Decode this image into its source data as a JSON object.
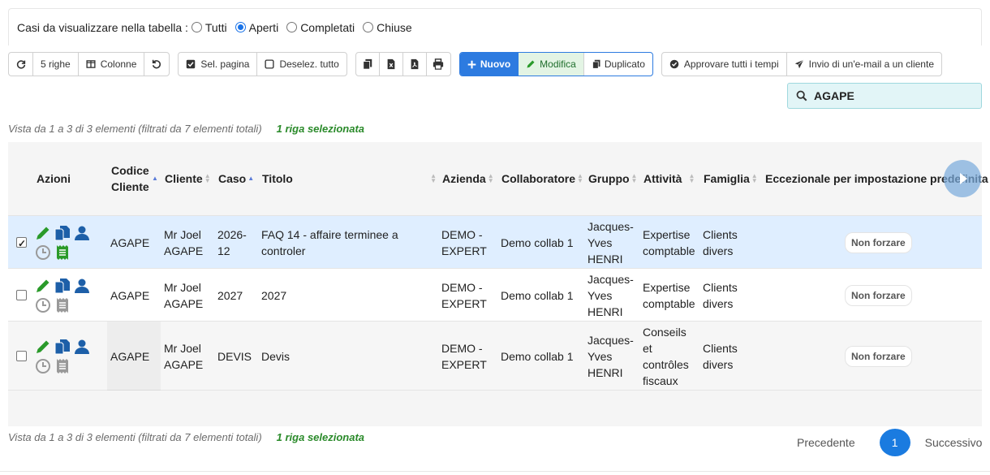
{
  "filter": {
    "label": "Casi da visualizzare nella tabella :",
    "options": [
      "Tutti",
      "Aperti",
      "Completati",
      "Chiuse"
    ],
    "selected": "Aperti"
  },
  "toolbar": {
    "rows_label": "5 righe",
    "columns_label": "Colonne",
    "select_page_label": "Sel. pagina",
    "deselect_all_label": "Deselez. tutto",
    "new_label": "Nuovo",
    "edit_label": "Modifica",
    "duplicate_label": "Duplicato",
    "approve_label": "Approvare tutti i tempi",
    "email_label": "Invio di un'e-mail a un cliente"
  },
  "search": {
    "value": "AGAPE"
  },
  "info": {
    "summary": "Vista da 1 a 3 di 3 elementi (filtrati da 7 elementi totali)",
    "selected": "1 riga selezionata"
  },
  "table": {
    "headers": {
      "azioni": "Azioni",
      "codice_cliente": "Codice Cliente",
      "cliente": "Cliente",
      "caso": "Caso",
      "titolo": "Titolo",
      "azienda": "Azienda",
      "collaboratore": "Collaboratore",
      "gruppo": "Gruppo",
      "attivita": "Attività",
      "famiglia": "Famiglia",
      "eccezionale": "Eccezionale per impostazione predefinita"
    },
    "rows": [
      {
        "selected": true,
        "codice": "AGAPE",
        "cliente": "Mr Joel AGAPE",
        "caso": "2026-12",
        "titolo": "FAQ 14 - affaire terminee a controler",
        "azienda": "DEMO - EXPERT",
        "collaboratore": "Demo collab 1",
        "gruppo": "Jacques-Yves HENRI",
        "attivita": "Expertise comptable",
        "famiglia": "Clients divers",
        "eccezionale": "Non forzare"
      },
      {
        "selected": false,
        "codice": "AGAPE",
        "cliente": "Mr Joel AGAPE",
        "caso": "2027",
        "titolo": "2027",
        "azienda": "DEMO - EXPERT",
        "collaboratore": "Demo collab 1",
        "gruppo": "Jacques-Yves HENRI",
        "attivita": "Expertise comptable",
        "famiglia": "Clients divers",
        "eccezionale": "Non forzare"
      },
      {
        "selected": false,
        "codice": "AGAPE",
        "cliente": "Mr Joel AGAPE",
        "caso": "DEVIS",
        "titolo": "Devis",
        "azienda": "DEMO - EXPERT",
        "collaboratore": "Demo collab 1",
        "gruppo": "Jacques-Yves HENRI",
        "attivita": "Conseils et contrôles fiscaux",
        "famiglia": "Clients divers",
        "eccezionale": "Non forzare"
      }
    ]
  },
  "pagination": {
    "prev": "Precedente",
    "current": "1",
    "next": "Successivo"
  },
  "colors": {
    "primary": "#2d7be0",
    "selected_row": "#dfeeff",
    "icon_green": "#2a9a2a",
    "icon_blue": "#1d5fa8",
    "icon_gray": "#999999"
  }
}
